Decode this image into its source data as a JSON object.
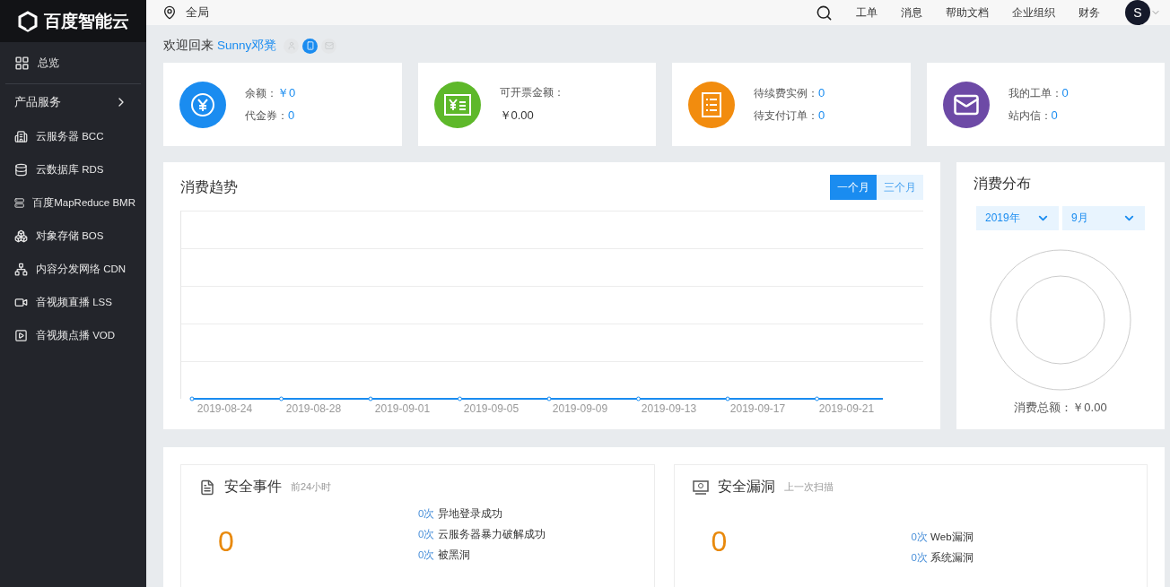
{
  "sidebar": {
    "logo": "百度智能云",
    "overview": {
      "label": "总览",
      "selected": false
    },
    "section": {
      "label": "产品服务",
      "expanded": false
    },
    "items": [
      {
        "label": "云服务器 BCC"
      },
      {
        "label": "云数据库 RDS"
      },
      {
        "label": "百度MapReduce BMR"
      },
      {
        "label": "对象存储 BOS"
      },
      {
        "label": "内容分发网络 CDN"
      },
      {
        "label": "音视频直播 LSS"
      },
      {
        "label": "音视频点播 VOD"
      }
    ]
  },
  "topbar": {
    "region": "全局",
    "links": [
      "工单",
      "消息",
      "帮助文档",
      "企业组织",
      "财务"
    ],
    "avatar": "S"
  },
  "welcome": {
    "greeting": "欢迎回来",
    "user": "Sunny邓凳",
    "badges": [
      {
        "verified": false
      },
      {
        "verified": true
      },
      {
        "verified": false
      }
    ]
  },
  "stat_cards": [
    {
      "color": "#1a8cf0",
      "kind": "pairs",
      "lines": [
        {
          "label": "余额：",
          "value": "￥0"
        },
        {
          "label": "代金券：",
          "value": "0"
        }
      ]
    },
    {
      "color": "#5eb82a",
      "kind": "stacked",
      "lines": [
        {
          "label": "可开票金额：",
          "value": "￥0.00"
        }
      ]
    },
    {
      "color": "#f28c0e",
      "kind": "pairs",
      "lines": [
        {
          "label": "待续费实例：",
          "value": "0"
        },
        {
          "label": "待支付订单：",
          "value": "0"
        }
      ]
    },
    {
      "color": "#6d4aa6",
      "kind": "pairs",
      "lines": [
        {
          "label": "我的工单：",
          "value": "0"
        },
        {
          "label": "站内信：",
          "value": "0"
        }
      ]
    }
  ],
  "trend": {
    "title": "消费趋势",
    "tabs": [
      {
        "label": "一个月",
        "selected": true
      },
      {
        "label": "三个月",
        "selected": false
      }
    ],
    "axis_labels": [
      "2019-08-24",
      "2019-08-28",
      "2019-09-01",
      "2019-09-05",
      "2019-09-09",
      "2019-09-13",
      "2019-09-17",
      "2019-09-21"
    ]
  },
  "distribution": {
    "title": "消费分布",
    "selects": [
      {
        "value": "2019年"
      },
      {
        "value": "9月"
      }
    ],
    "total_label": "消费总额：",
    "total": "￥0.00"
  },
  "security": [
    {
      "title": "安全事件",
      "subtitle": "前24小时",
      "count": "0",
      "items": [
        {
          "count": "0次",
          "label": "异地登录成功"
        },
        {
          "count": "0次",
          "label": "云服务器暴力破解成功"
        },
        {
          "count": "0次",
          "label": "被黑洞"
        }
      ]
    },
    {
      "title": "安全漏洞",
      "subtitle": "上一次扫描",
      "count": "0",
      "items": [
        {
          "count": "0次",
          "label": "Web漏洞"
        },
        {
          "count": "0次",
          "label": "系统漏洞"
        }
      ]
    }
  ]
}
